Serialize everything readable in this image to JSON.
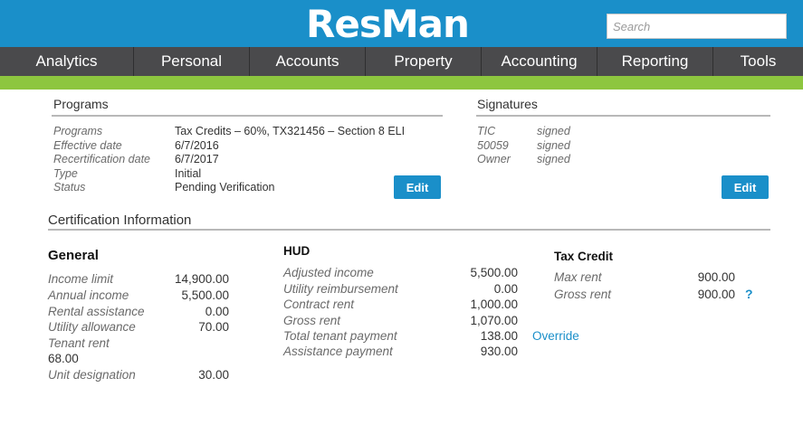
{
  "header": {
    "logo": "ResMan",
    "search": {
      "placeholder": "Search",
      "value": ""
    }
  },
  "nav": {
    "items": [
      "Analytics",
      "Personal",
      "Accounts",
      "Property",
      "Accounting",
      "Reporting",
      "Tools"
    ]
  },
  "programs": {
    "title": "Programs",
    "rows": [
      {
        "label": "Programs",
        "value": "Tax Credits – 60%, TX321456 – Section 8 ELI"
      },
      {
        "label": "Effective date",
        "value": "6/7/2016"
      },
      {
        "label": "Recertification date",
        "value": "6/7/2017"
      },
      {
        "label": "Type",
        "value": "Initial"
      },
      {
        "label": "Status",
        "value": "Pending Verification"
      }
    ],
    "edit_label": "Edit"
  },
  "signatures": {
    "title": "Signatures",
    "rows": [
      {
        "label": "TIC",
        "value": "signed"
      },
      {
        "label": "50059",
        "value": "signed"
      },
      {
        "label": "Owner",
        "value": "signed"
      }
    ],
    "edit_label": "Edit"
  },
  "certification": {
    "title": "Certification Information",
    "general": {
      "heading": "General",
      "rows": [
        {
          "label": "Income limit",
          "value": "14,900.00"
        },
        {
          "label": "Annual income",
          "value": "5,500.00"
        },
        {
          "label": "Rental assistance",
          "value": "0.00"
        },
        {
          "label": "Utility allowance",
          "value": "70.00"
        },
        {
          "label": "Tenant rent",
          "value": "68.00"
        },
        {
          "label": "Unit designation",
          "value": "30.00"
        }
      ]
    },
    "hud": {
      "heading": "HUD",
      "rows": [
        {
          "label": "Adjusted income",
          "value": "5,500.00"
        },
        {
          "label": "Utility reimbursement",
          "value": "0.00"
        },
        {
          "label": "Contract rent",
          "value": "1,000.00"
        },
        {
          "label": "Gross rent",
          "value": "1,070.00"
        },
        {
          "label": "Total tenant payment",
          "value": "138.00"
        },
        {
          "label": "Assistance payment",
          "value": "930.00"
        }
      ],
      "override_label": "Override"
    },
    "tax_credit": {
      "heading": "Tax Credit",
      "rows": [
        {
          "label": "Max rent",
          "value": "900.00"
        },
        {
          "label": "Gross rent",
          "value": "900.00"
        }
      ],
      "help_label": "?"
    }
  },
  "colors": {
    "brand_blue": "#1a8fc9",
    "nav_gray": "#4a4a4c",
    "accent_green": "#8dc63f"
  }
}
